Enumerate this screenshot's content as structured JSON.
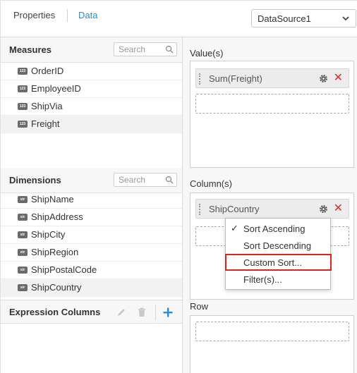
{
  "header": {
    "tab_properties": "Properties",
    "tab_data": "Data",
    "datasource": "DataSource1"
  },
  "measures": {
    "title": "Measures",
    "search_placeholder": "Search",
    "badge": "123",
    "items": [
      "OrderID",
      "EmployeeID",
      "ShipVia",
      "Freight"
    ]
  },
  "dimensions": {
    "title": "Dimensions",
    "search_placeholder": "Search",
    "badge": "str",
    "items": [
      "ShipName",
      "ShipAddress",
      "ShipCity",
      "ShipRegion",
      "ShipPostalCode",
      "ShipCountry"
    ]
  },
  "expression": {
    "title": "Expression Columns"
  },
  "values": {
    "title": "Value(s)",
    "pill": "Sum(Freight)"
  },
  "columns": {
    "title": "Column(s)",
    "pill": "ShipCountry"
  },
  "row": {
    "title": "Row"
  },
  "menu": {
    "check": "✓",
    "items": [
      "Sort Ascending",
      "Sort Descending",
      "Custom Sort...",
      "Filter(s)..."
    ]
  },
  "colors": {
    "accent": "#2a8dd4",
    "remove": "#d9332f",
    "highlight": "#d9251d"
  }
}
